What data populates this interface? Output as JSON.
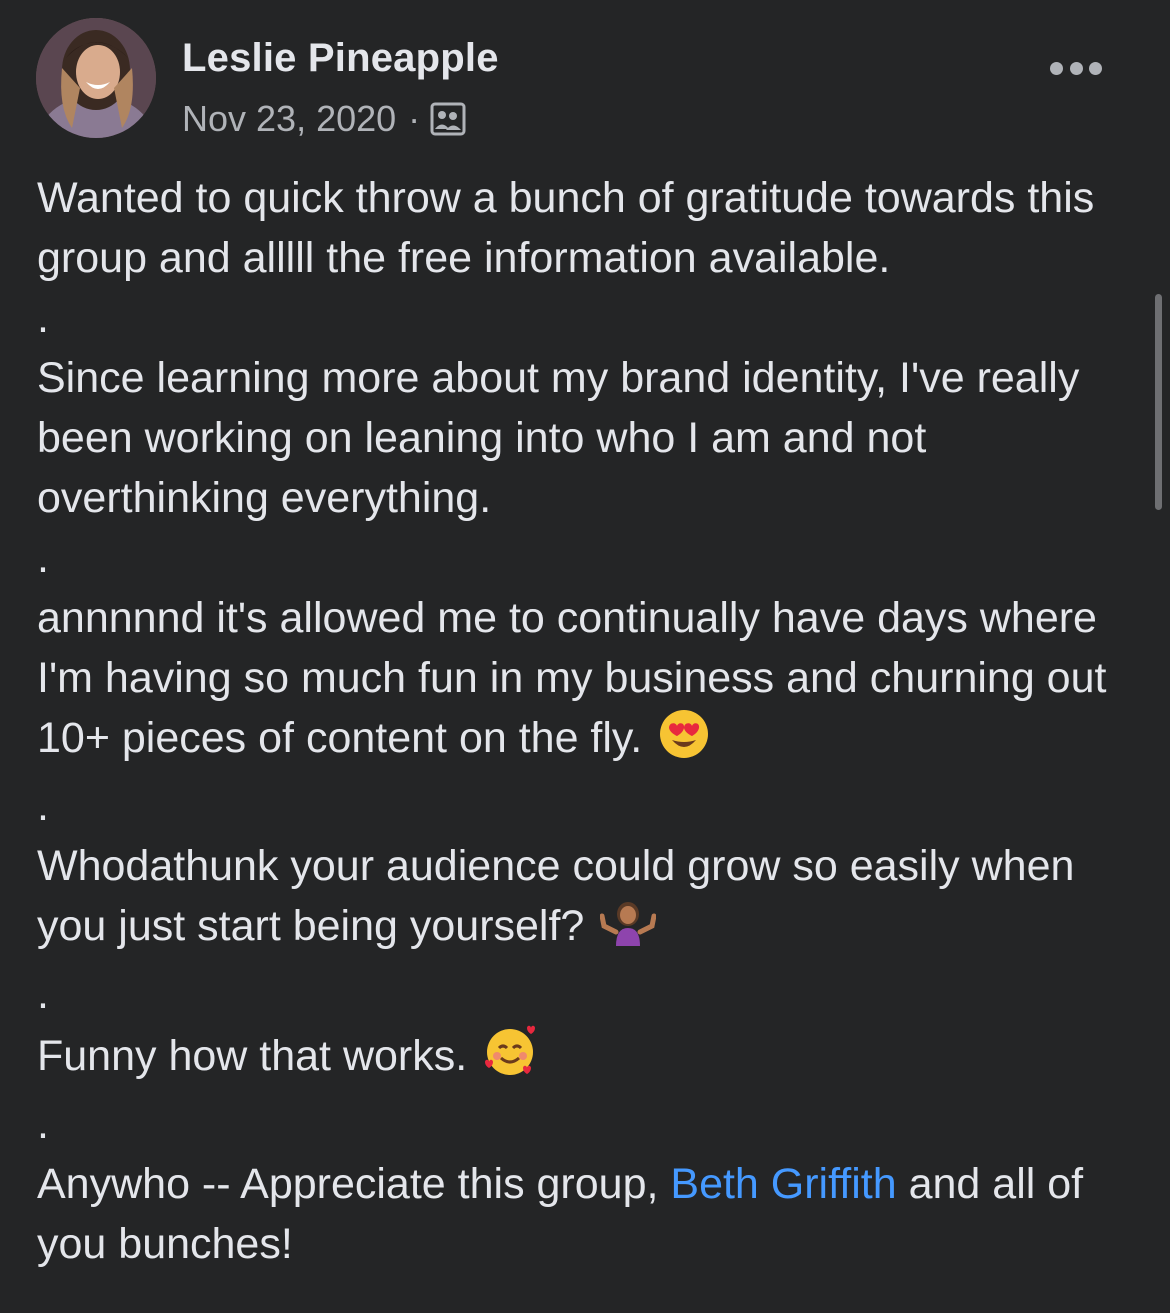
{
  "post": {
    "author": "Leslie Pineapple",
    "date": "Nov 23, 2020",
    "separator": "·",
    "audience_icon": "group-members-icon",
    "more_icon": "more-options-icon",
    "paragraphs": {
      "p1": "Wanted to quick throw a bunch of gratitude towards this group and alllll the free information available.",
      "sep": ".",
      "p2": "Since learning more about my brand identity, I've really been working on leaning into who I am and not overthinking everything.",
      "p3": "annnnnd it's allowed me to continually have days where I'm having so much fun in my business and churning out 10+ pieces of content on the fly.",
      "p4": "Whodathunk your audience could grow so easily when you just start being yourself?",
      "p5": "Funny how that works.",
      "p6_before": "Anywho -- Appreciate this group, ",
      "p6_mention": "Beth Griffith",
      "p6_after": " and all of you bunches!"
    },
    "emojis": {
      "e1": "heart-eyes-emoji",
      "e2": "shrugging-woman-emoji",
      "e3": "smiling-face-with-hearts-emoji"
    }
  },
  "colors": {
    "background": "#242526",
    "primary_text": "#e4e6eb",
    "secondary_text": "#b0b3b8",
    "mention": "#4599ff"
  }
}
